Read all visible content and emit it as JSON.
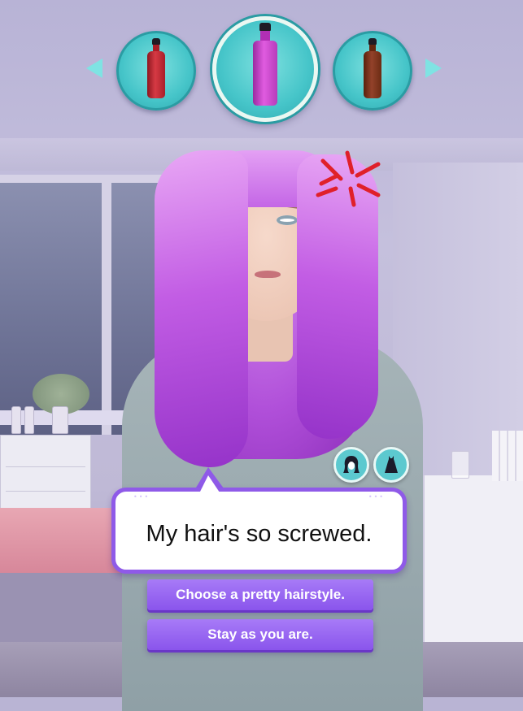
{
  "hair_selector": {
    "options": [
      {
        "name": "red-dye-bottle",
        "color": "#c0242d",
        "selected": false
      },
      {
        "name": "purple-dye-bottle",
        "color": "#c93ec8",
        "selected": true
      },
      {
        "name": "brown-dye-bottle",
        "color": "#7a3118",
        "selected": false
      }
    ],
    "accent_color": "#46c5c9"
  },
  "outfit_icons": [
    "hair-icon",
    "dress-icon"
  ],
  "dialogue": {
    "text": "My hair's so screwed.",
    "border_color": "#8f5ae8"
  },
  "choices": [
    {
      "label": "Choose a pretty hairstyle."
    },
    {
      "label": "Stay as you are."
    }
  ]
}
